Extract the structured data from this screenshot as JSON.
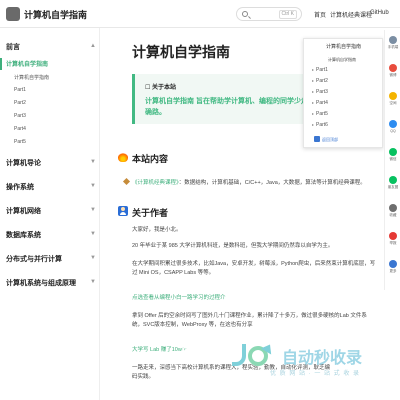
{
  "header": {
    "site_title": "计算机自学指南",
    "search_kbd": "Ctrl K",
    "nav": [
      "首页",
      "计算机经典课程",
      "GitHub"
    ]
  },
  "sidebar": {
    "groups": [
      {
        "label": "前言",
        "expanded": true
      },
      {
        "label": "计算机导论"
      },
      {
        "label": "操作系统"
      },
      {
        "label": "计算机网络"
      },
      {
        "label": "数据库系统"
      },
      {
        "label": "分布式与并行计算"
      },
      {
        "label": "计算机系统与组成原理"
      }
    ],
    "active_item": "计算机自学指南",
    "sub_items": [
      "计算机自学指南",
      "Part1",
      "Part2",
      "Part3",
      "Part4",
      "Part5"
    ]
  },
  "main": {
    "title": "计算机自学指南",
    "tip": {
      "title": "关于本站",
      "body": "计算机自学指南 旨在帮助学计算机、编程的同学少走弯路，我到一条正确路。"
    },
    "section_content": {
      "heading": "本站内容",
      "bullet_link": "《计算机经典课程》",
      "bullet_text": "：数据结构，计算机基础，C/C++，Java，大数据，算法等计算机经典课程。"
    },
    "section_author": {
      "heading": "关于作者",
      "paragraphs": [
        "大家好，我是小北。",
        "20 年毕业于某 985 大学计算机科班，是数科班，但我大学期间仍然靠以自学为主。",
        "在大学期间积累过很多技术，比如Java，安卓开发，树莓派，Python爬虫，后来然束计算机底层，写过 Mini OS，CSAPP Labs 等等。",
        "点选查看从编程小白一路学习的过程介",
        "拿到 Offer 后的空余时间写了图外几十门课程作业，累计降了十多万，做过很多硬核的Lab 文件系统，SVC版本控制，WebProxy 等，在这也有分享",
        "大学写 Lab 赚了10w☞",
        "一路走来，深感当下高校计算机系的课程大，程实验，勤教，自动化评测，耿芝编码实践。"
      ],
      "green_indices": [
        3,
        5
      ]
    },
    "toc": {
      "title": "计算机自学指南",
      "subtitle": "计算机自学指南",
      "items": [
        "Part1",
        "Part2",
        "Part3",
        "Part4",
        "Part5",
        "Part6"
      ],
      "footer": "返回顶部"
    }
  },
  "sharebar": [
    {
      "label": "手机端",
      "color": "#7b8ea3"
    },
    {
      "label": "微博",
      "color": "#e84c3d"
    },
    {
      "label": "空间",
      "color": "#f4b400"
    },
    {
      "label": "QQ",
      "color": "#2d8cf0"
    },
    {
      "label": "微信",
      "color": "#07c160"
    },
    {
      "label": "朋友圈",
      "color": "#07c160"
    },
    {
      "label": "收藏",
      "color": "#6e6e6e"
    },
    {
      "label": "举报",
      "color": "#e53935"
    },
    {
      "label": "更多",
      "color": "#3a76d1"
    }
  ],
  "watermark": {
    "text": "自动秒收录",
    "sub": "优 质 网 站 · 一 站 式 收 录"
  },
  "colors": {
    "accent": "#3eaf7c",
    "tip_bg": "#f1f8f4"
  }
}
